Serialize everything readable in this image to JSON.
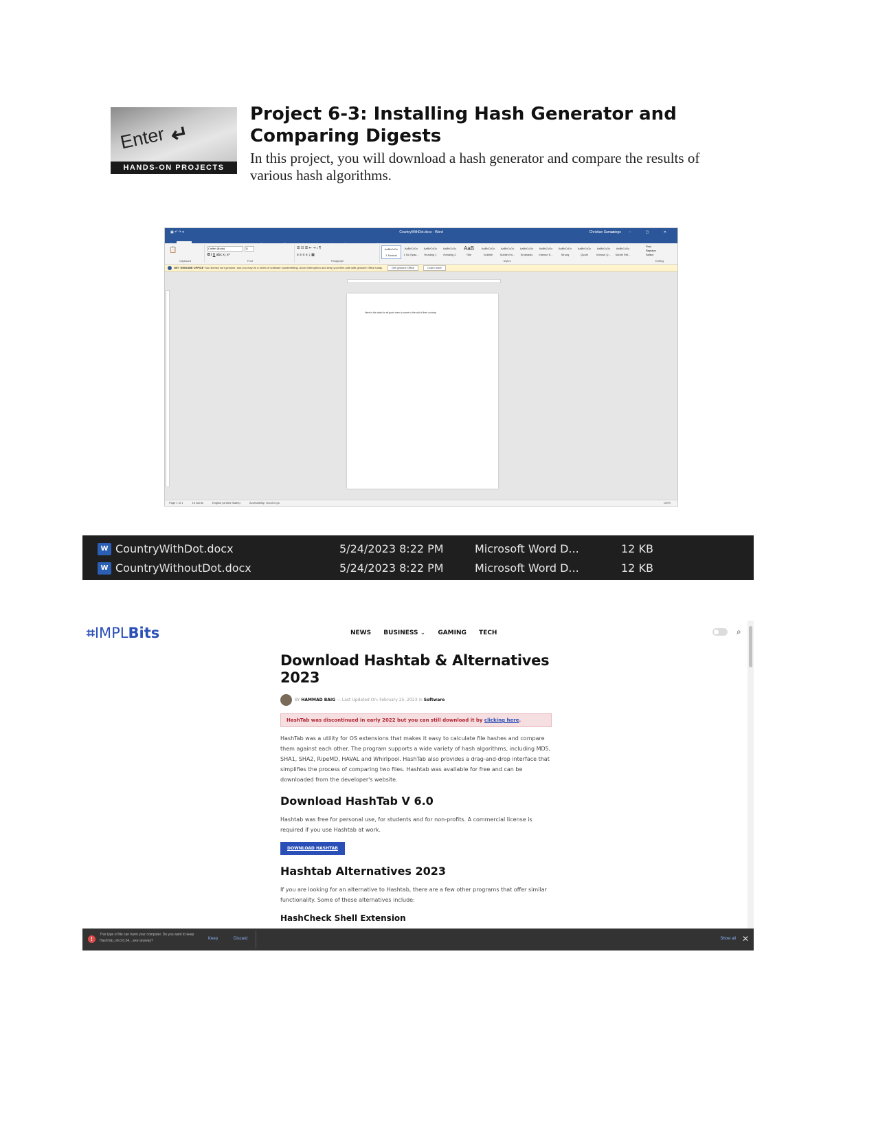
{
  "project": {
    "badge_key": "Enter",
    "badge_arrow": "↵",
    "badge_label": "HANDS-ON PROJECTS",
    "title": "Project 6-3: Installing Hash Generator and Comparing Digests",
    "description": "In this project, you will download a hash generator and compare the results of various hash algorithms."
  },
  "word": {
    "doc_title": "CountryWithDot.docx - Word",
    "user": "Christian Samaniego",
    "tabs": [
      "File",
      "Home",
      "Insert",
      "Draw",
      "Design",
      "Layout",
      "References",
      "Mailings",
      "Review",
      "View",
      "Help",
      "Tell me what you want to do"
    ],
    "active_tab": "Home",
    "font_name": "Calibri (Body)",
    "font_size": "11",
    "groups": [
      "Clipboard",
      "Font",
      "Paragraph",
      "Styles",
      "Editing"
    ],
    "styles": [
      "1 Normal",
      "1 No Spac...",
      "Heading 1",
      "Heading 2",
      "Title",
      "Subtitle",
      "Subtle Em...",
      "Emphasis",
      "Intense E...",
      "Strong",
      "Quote",
      "Intense Q...",
      "Subtle Ref..."
    ],
    "style_sample": "AaBbCcDc",
    "style_big": "AaB",
    "editing": [
      "Find",
      "Replace",
      "Select"
    ],
    "msg_title": "GET GENUINE OFFICE",
    "msg_text": "Your license isn't genuine, and you may be a victim of software counterfeiting. Avoid interruption and keep your files safe with genuine Office today.",
    "msg_btn1": "Get genuine Office",
    "msg_btn2": "Learn more",
    "page_text": "Here is the data for all good men to come to the aid of their country.",
    "status_page": "Page 1 of 1",
    "status_words": "15 words",
    "status_lang": "English (United States)",
    "status_access": "Accessibility: Good to go",
    "status_zoom": "100%"
  },
  "explorer": {
    "files": [
      {
        "name": "CountryWithDot.docx",
        "date": "5/24/2023 8:22 PM",
        "type": "Microsoft Word D...",
        "size": "12 KB"
      },
      {
        "name": "CountryWithoutDot.docx",
        "date": "5/24/2023 8:22 PM",
        "type": "Microsoft Word D...",
        "size": "12 KB"
      }
    ],
    "file_icon": "W"
  },
  "site": {
    "logo_mark": "⌗",
    "logo_impl": "IMPL",
    "logo_bits": "Bits",
    "nav": [
      "NEWS",
      "BUSINESS",
      "GAMING",
      "TECH"
    ],
    "nav_dropdown": "⌄",
    "search_icon": "⌕",
    "title": "Download Hashtab & Alternatives 2023",
    "by_prefix": "BY",
    "author": "HAMMAD BAIG",
    "updated": "— Last Updated On: February 25, 2023 in",
    "category": "Software",
    "notice": "HashTab was discontinued in early 2022 but you can still download it by",
    "notice_link": "clicking here",
    "para1": "HashTab was a utility for OS extensions that makes it easy to calculate file hashes and compare them against each other. The program supports a wide variety of hash algorithms, including MD5, SHA1, SHA2, RipeMD, HAVAL and Whirlpool. HashTab also provides a drag-and-drop interface that simplifies the process of comparing two files. Hashtab was available for free and can be downloaded from the developer's website.",
    "h2_download": "Download HashTab V 6.0",
    "para2": "Hashtab was free for personal use, for students and for non-profits. A commercial license is required if you use Hashtab at work.",
    "download_btn": "DOWNLOAD HASHTAB",
    "h2_alternatives": "Hashtab Alternatives 2023",
    "para3": "If you are looking for an alternative to Hashtab, there are a few other programs that offer similar functionality. Some of these alternatives include:",
    "h3_hashcheck": "HashCheck Shell Extension"
  },
  "download_bar": {
    "warning": "This type of file can harm your computer. Do you want to keep HashTab_v6.0.0.34....exe anyway?",
    "keep": "Keep",
    "discard": "Discard",
    "show_all": "Show all",
    "close": "✕"
  }
}
